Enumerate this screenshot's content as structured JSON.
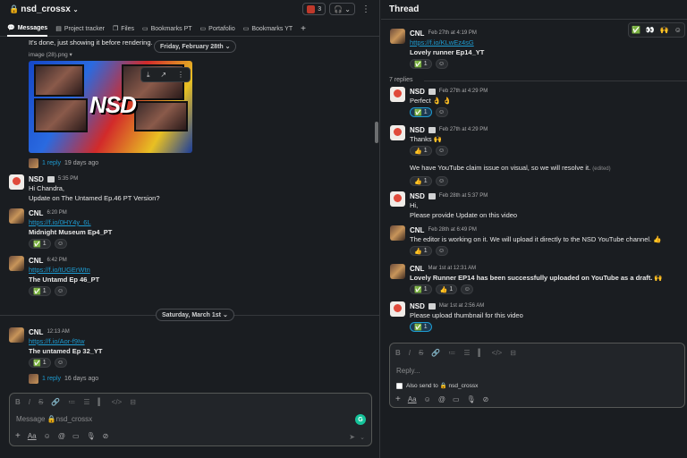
{
  "channel": {
    "name": "nsd_crossx",
    "member_count": "3",
    "tabs": [
      {
        "label": "Messages",
        "icon": "chat-icon"
      },
      {
        "label": "Project tracker",
        "icon": "list-icon"
      },
      {
        "label": "Files",
        "icon": "files-icon"
      },
      {
        "label": "Bookmarks PT",
        "icon": "folder-icon"
      },
      {
        "label": "Portafolio",
        "icon": "folder-icon"
      },
      {
        "label": "Bookmarks YT",
        "icon": "folder-icon"
      }
    ],
    "add_tab": "+"
  },
  "feed": {
    "top_text": "It's done, just showing it before rendering.",
    "date1": "Friday, February 28th",
    "image_label": "image (28).png",
    "image_replies": {
      "count": "1 reply",
      "ago": "19 days ago"
    },
    "thumb_text": "NSD",
    "messages": [
      {
        "author": "NSD",
        "time": "5:35 PM",
        "lines": [
          "Hi Chandra,",
          "Update on The Untamed Ep.46 PT Version?"
        ]
      },
      {
        "author": "CNL",
        "time": "6:20 PM",
        "link": "https://f.io/0HY4y_6L",
        "text": "Midnight Museum Ep4_PT",
        "reaction": "1"
      },
      {
        "author": "CNL",
        "time": "6:42 PM",
        "link": "https://f.io/tUGErWtn",
        "text": "The Untamd Ep 46_PT",
        "reaction": "1"
      }
    ],
    "date2": "Saturday, March 1st",
    "last": {
      "author": "CNL",
      "time": "12:13 AM",
      "link": "https://f.io/Aor-f9Iw",
      "text": "The untamed Ep 32_YT",
      "reaction": "1",
      "replies": "1 reply",
      "ago": "16 days ago"
    }
  },
  "composer": {
    "placeholder": "Message 🔒nsd_crossx",
    "font_label": "Aa"
  },
  "thread": {
    "title": "Thread",
    "parent": {
      "author": "CNL",
      "time": "Feb 27th at 4:19 PM",
      "link": "https://f.io/KLwEz4sG",
      "text": "Lovely runner Ep14_YT",
      "reaction": "1"
    },
    "replies_label": "7 replies",
    "replies": [
      {
        "author": "NSD",
        "time": "Feb 27th at 4:29 PM",
        "text": "Perfect 👌 👌",
        "reaction_emoji": "✅",
        "reaction": "1",
        "mine": true
      },
      {
        "author": "NSD",
        "time": "Feb 27th at 4:29 PM",
        "text": "Thanks 🙌",
        "reaction_emoji": "👍",
        "reaction": "1",
        "mine": false
      },
      {
        "author": "",
        "time": "",
        "text": "We have YouTube claim issue on visual, so we will resolve it.",
        "edited": "(edited)",
        "reaction_emoji": "👍",
        "reaction": "1",
        "mine": false
      },
      {
        "author": "NSD",
        "time": "Feb 28th at 5:37 PM",
        "lines": [
          "Hi,",
          "Please provide Update on this video"
        ]
      },
      {
        "author": "CNL",
        "time": "Feb 28th at 6:49 PM",
        "text": "The editor is working on it. We will upload it directly to the NSD YouTube channel. 👍",
        "reaction_emoji": "👍",
        "reaction": "1",
        "mine": false
      },
      {
        "author": "CNL",
        "time": "Mar 1st at 12:31 AM",
        "text": "Lovely Runner EP14 has been successfully uploaded on YouTube as a draft. 🙌",
        "reaction_emoji": "✅",
        "reaction": "1",
        "reaction2_emoji": "👍",
        "reaction2": "1",
        "mine": false
      },
      {
        "author": "NSD",
        "time": "Mar 1st at 2:56 AM",
        "text": "Please upload thumbnail for this video",
        "reaction_emoji": "✅",
        "reaction": "1",
        "mine": true
      }
    ],
    "composer": {
      "placeholder": "Reply...",
      "also_send": "Also send to 🔒 nsd_crossx",
      "font_label": "Aa"
    }
  }
}
